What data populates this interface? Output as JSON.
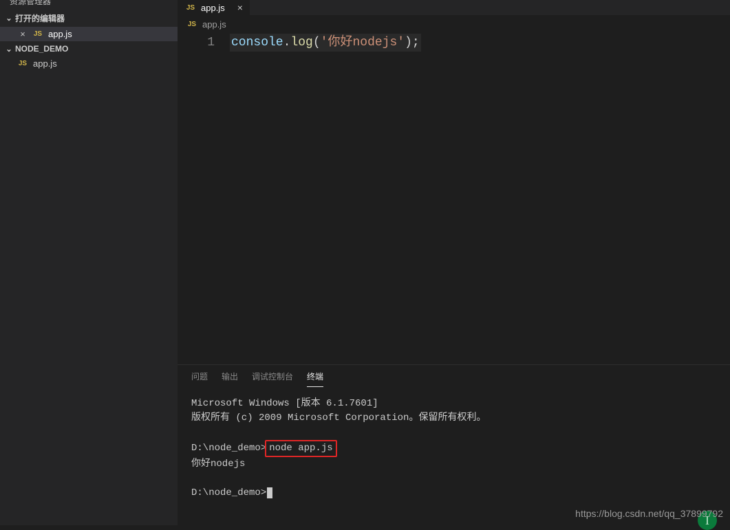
{
  "sidebar": {
    "title": "资源管理器",
    "sections": {
      "openEditors": {
        "label": "打开的编辑器",
        "items": [
          {
            "file": "app.js"
          }
        ]
      },
      "folder": {
        "label": "NODE_DEMO",
        "items": [
          {
            "file": "app.js"
          }
        ]
      }
    }
  },
  "tabs": [
    {
      "file": "app.js"
    }
  ],
  "breadcrumb": {
    "file": "app.js"
  },
  "editor": {
    "lineNumber": "1",
    "code": {
      "obj": "console",
      "dot": ".",
      "method": "log",
      "open": "(",
      "q1": "'",
      "str": "你好nodejs",
      "q2": "'",
      "close": ")",
      "semi": ";"
    }
  },
  "panel": {
    "tabs": {
      "problems": "问题",
      "output": "输出",
      "debug": "调试控制台",
      "terminal": "终端"
    },
    "terminal": {
      "line1": "Microsoft Windows [版本 6.1.7601]",
      "line2": "版权所有 (c) 2009 Microsoft Corporation。保留所有权利。",
      "prompt1": "D:\\node_demo>",
      "cmd": "node app.js",
      "output": "你好nodejs",
      "prompt2": "D:\\node_demo>"
    }
  },
  "watermark": "https://blog.csdn.net/qq_37899792",
  "icons": {
    "js": "JS"
  }
}
